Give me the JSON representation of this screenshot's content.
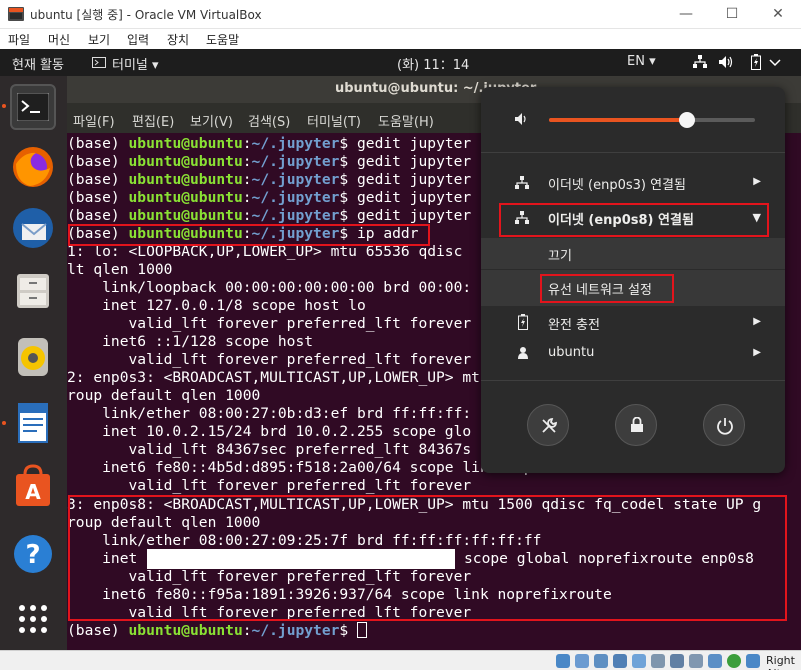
{
  "window": {
    "title": "ubuntu [실행 중] - Oracle VM VirtualBox",
    "minimize": "—",
    "maximize": "☐",
    "close": "✕"
  },
  "vb_menu": [
    "파일",
    "머신",
    "보기",
    "입력",
    "장치",
    "도움말"
  ],
  "top_panel": {
    "activities": "현재 활동",
    "app_menu": "터미널 ▾",
    "clock": "(화) 11：14",
    "lang": "EN ▾"
  },
  "terminal": {
    "title": "ubuntu@ubuntu: ~/.jupyter",
    "menus": [
      "파일(F)",
      "편집(E)",
      "보기(V)",
      "검색(S)",
      "터미널(T)",
      "도움말(H)"
    ],
    "prompt": {
      "env": "(base) ",
      "user": "ubuntu@ubuntu",
      "colon": ":",
      "path": "~/.jupyter",
      "dollar": "$ "
    },
    "commands": [
      "gedit jupyter",
      "gedit jupyter",
      "gedit jupyter",
      "gedit jupyter",
      "gedit jupyter",
      "ip addr"
    ],
    "output": [
      "1: lo: <LOOPBACK,UP,LOWER_UP> mtu 65536 qdisc",
      "lt qlen 1000",
      "    link/loopback 00:00:00:00:00:00 brd 00:00:",
      "    inet 127.0.0.1/8 scope host lo",
      "       valid_lft forever preferred_lft forever",
      "    inet6 ::1/128 scope host",
      "       valid_lft forever preferred_lft forever",
      "2: enp0s3: <BROADCAST,MULTICAST,UP,LOWER_UP> mt",
      "roup default qlen 1000",
      "    link/ether 08:00:27:0b:d3:ef brd ff:ff:ff:",
      "    inet 10.0.2.15/24 brd 10.0.2.255 scope glo",
      "       valid_lft 84367sec preferred_lft 84367s",
      "    inet6 fe80::4b5d:d895:f518:2a00/64 scope link noprefixroute",
      "       valid_lft forever preferred_lft forever",
      "3: enp0s8: <BROADCAST,MULTICAST,UP,LOWER_UP> mtu 1500 qdisc fq_codel state UP g",
      "roup default qlen 1000",
      "    link/ether 08:00:27:09:25:7f brd ff:ff:ff:ff:ff:ff",
      "    inet",
      "       valid_lft forever preferred_lft forever",
      "    inet6 fe80::f95a:1891:3926:937/64 scope link noprefixroute",
      "       valid_lft forever preferred_lft forever"
    ],
    "inet_tail": "scope global noprefixroute enp0s8"
  },
  "popup": {
    "volume_level": 0.67,
    "eth1": "이더넷 (enp0s3) 연결됨",
    "eth2": "이더넷 (enp0s8) 연결됨",
    "disconnect": "끄기",
    "wired_settings": "유선 네트워크 설정",
    "battery": "완전 충전",
    "user": "ubuntu"
  },
  "statusbar": {
    "host_key": "Right Alt"
  },
  "colors": {
    "accent": "#e95420",
    "highlight": "#e2141c",
    "terminal_bg": "#300a24"
  }
}
